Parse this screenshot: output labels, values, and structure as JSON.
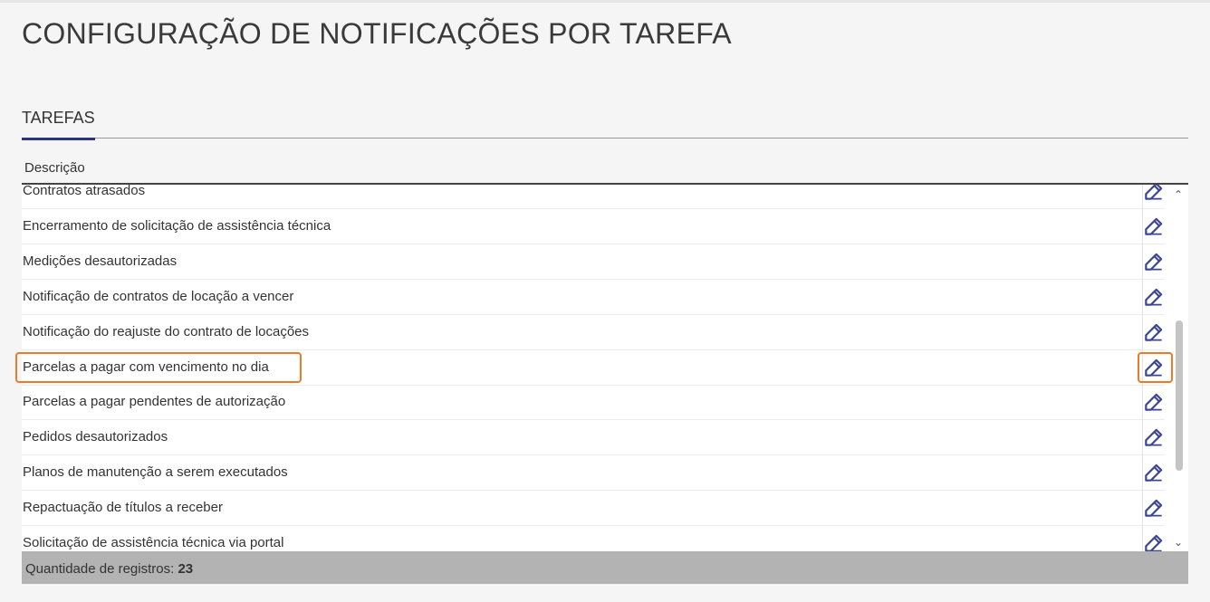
{
  "page": {
    "title": "CONFIGURAÇÃO DE NOTIFICAÇÕES POR TAREFA"
  },
  "tabs": [
    {
      "label": "TAREFAS",
      "active": true
    }
  ],
  "grid": {
    "column_header": "Descrição",
    "rows": [
      {
        "label": "Contratos atrasados"
      },
      {
        "label": "Encerramento de solicitação de assistência técnica"
      },
      {
        "label": "Medições desautorizadas"
      },
      {
        "label": "Notificação de contratos de locação a vencer"
      },
      {
        "label": "Notificação do reajuste do contrato de locações"
      },
      {
        "label": "Parcelas a pagar com vencimento no dia",
        "highlighted": true
      },
      {
        "label": "Parcelas a pagar pendentes de autorização"
      },
      {
        "label": "Pedidos desautorizados"
      },
      {
        "label": "Planos de manutenção a serem executados"
      },
      {
        "label": "Repactuação de títulos a receber"
      },
      {
        "label": "Solicitação de assistência técnica via portal"
      }
    ],
    "row_action_icon": "pencil-edit-icon"
  },
  "footer": {
    "label": "Quantidade de registros:",
    "count": "23"
  },
  "colors": {
    "accent": "#2b3478",
    "icon": "#3b4590",
    "highlight": "#ee7a26",
    "footer_bg": "#b3b3b3"
  }
}
